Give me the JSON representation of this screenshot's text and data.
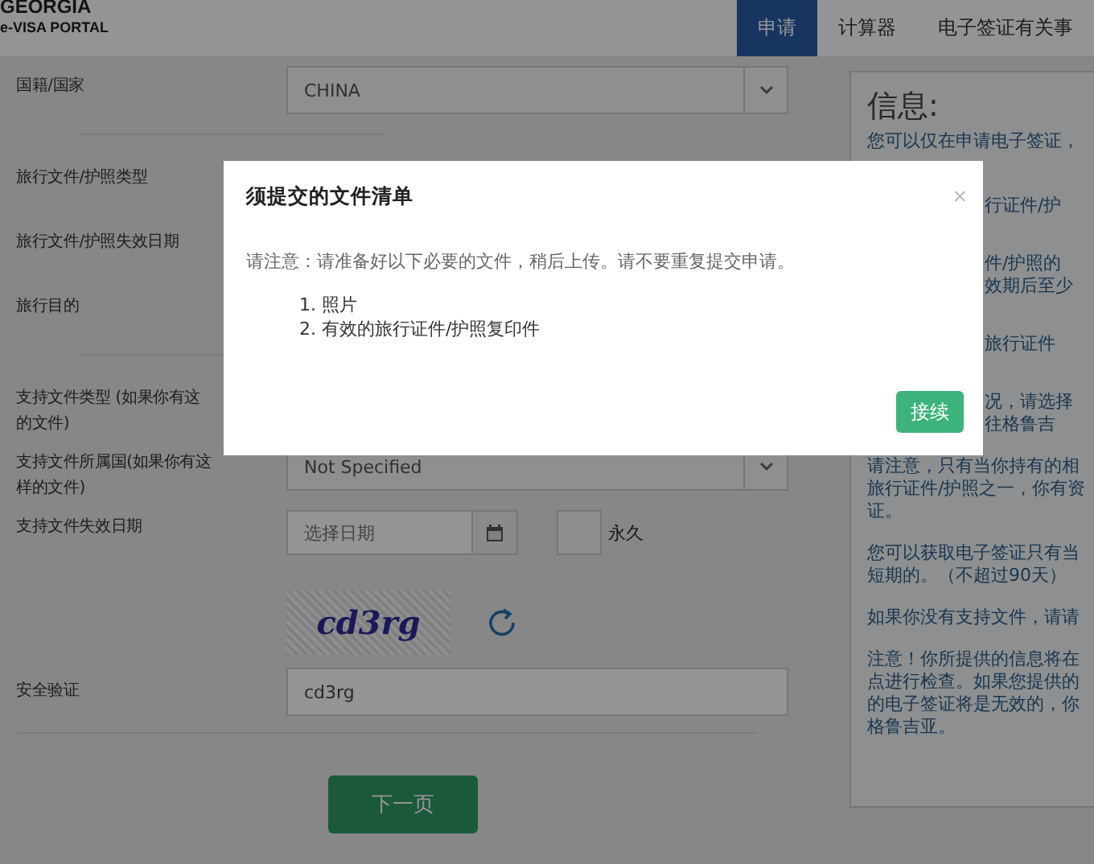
{
  "header": {
    "logo_top": "GEORGIA",
    "logo_bottom": "e-VISA PORTAL"
  },
  "nav": [
    {
      "label": "申请",
      "selected": true
    },
    {
      "label": "计算器",
      "selected": false
    },
    {
      "label": "电子签证有关事",
      "selected": false
    }
  ],
  "form": {
    "sections": [
      [
        {
          "kind": "select",
          "label": "国籍/国家",
          "value": "CHINA"
        }
      ],
      [
        {
          "kind": "blank",
          "label": "旅行文件/护照类型"
        },
        {
          "kind": "blank",
          "label": "旅行文件/护照失效日期"
        },
        {
          "kind": "blank",
          "label": "旅行目的"
        }
      ],
      [
        {
          "kind": "blank",
          "label": "支持文件类型 (如果你有这的文件)"
        },
        {
          "kind": "select",
          "label": "支持文件所属国(如果你有这样的文件)",
          "value": "Not Specified"
        },
        {
          "kind": "date",
          "label": "支持文件失效日期",
          "placeholder": "选择日期",
          "checkbox": {
            "label": "永久",
            "checked": false
          }
        },
        {
          "kind": "captcha",
          "value": "cd3rg"
        },
        {
          "kind": "input",
          "label": "安全验证",
          "value": "cd3rg"
        }
      ]
    ],
    "submit": "下一页"
  },
  "info": {
    "title": "信息:",
    "paragraphs": [
      {
        "lines": [
          {
            "kind": "full",
            "text": "您可以仅在申请电子签证，"
          },
          {
            "kind": "tail",
            "text": "行证件/护"
          }
        ]
      },
      {
        "lines": [
          {
            "kind": "tail",
            "text": "件/护照的"
          },
          {
            "kind": "tail",
            "text": "效期后至少"
          }
        ]
      },
      {
        "lines": [
          {
            "kind": "tail",
            "text": "旅行证件"
          }
        ]
      },
      {
        "lines": [
          {
            "kind": "tail",
            "text": "况，请选择"
          },
          {
            "kind": "tail",
            "text": "往格鲁吉"
          }
        ]
      },
      {
        "lines": [
          {
            "kind": "full",
            "text": "请注意，只有当你持有的相"
          },
          {
            "kind": "full",
            "text": "旅行证件/护照之一，你有资"
          },
          {
            "kind": "full",
            "text": "证。"
          }
        ]
      },
      {
        "lines": [
          {
            "kind": "full",
            "text": "您可以获取电子签证只有当"
          },
          {
            "kind": "full",
            "text": "短期的。（不超过90天）"
          }
        ]
      },
      {
        "lines": [
          {
            "kind": "full",
            "text": "如果你没有支持文件，请请"
          }
        ]
      },
      {
        "lines": [
          {
            "kind": "full",
            "text": "注意！你所提供的信息将在"
          },
          {
            "kind": "full",
            "text": "点进行检查。如果您提供的"
          },
          {
            "kind": "full",
            "text": "的电子签证将是无效的，你"
          },
          {
            "kind": "full",
            "text": "格鲁吉亚。"
          }
        ]
      }
    ]
  },
  "modal": {
    "title": "须提交的文件清单",
    "close": "×",
    "note": "请注意：请准备好以下必要的文件，稍后上传。请不要重复提交申请。",
    "items": [
      "1. 照片",
      "2. 有效的旅行证件/护照复印件"
    ],
    "button": "接续"
  }
}
